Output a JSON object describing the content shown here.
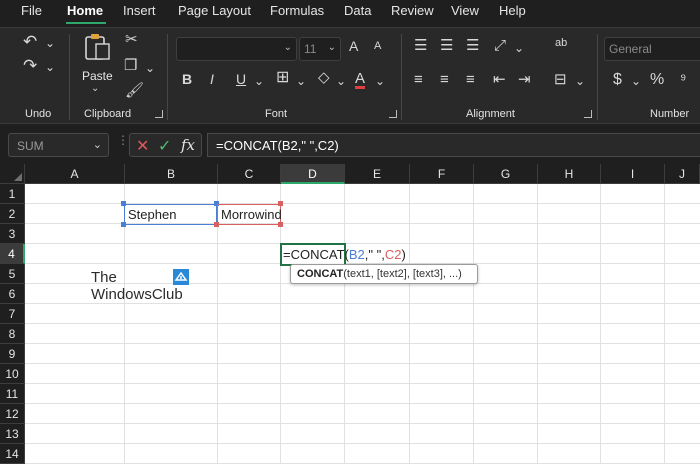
{
  "menu": {
    "items": [
      {
        "label": "File"
      },
      {
        "label": "Home"
      },
      {
        "label": "Insert"
      },
      {
        "label": "Page Layout"
      },
      {
        "label": "Formulas"
      },
      {
        "label": "Data"
      },
      {
        "label": "Review"
      },
      {
        "label": "View"
      },
      {
        "label": "Help"
      }
    ],
    "active": "Home",
    "accent": "#2ea76b"
  },
  "ribbon": {
    "groups": {
      "undo": "Undo",
      "clipboard": "Clipboard",
      "font": "Font",
      "alignment": "Alignment",
      "number": "Number"
    },
    "paste_label": "Paste",
    "font_size": "11",
    "number_format": "General",
    "currency_symbol": "$",
    "percent_symbol": "%",
    "bold_glyph": "B",
    "italic_glyph": "I",
    "underline_glyph": "U",
    "font_color_glyph": "A",
    "grow_font_glyph": "A",
    "shrink_font_glyph": "A",
    "wrap_glyph": "ab"
  },
  "formula_bar": {
    "name_box": "SUM",
    "fx_label": "fx",
    "formula": "=CONCAT(B2,\" \",C2)"
  },
  "grid": {
    "columns": [
      "A",
      "B",
      "C",
      "D",
      "E",
      "F",
      "G",
      "H",
      "I",
      "J"
    ],
    "selected_column": "D",
    "rows": [
      "1",
      "2",
      "3",
      "4",
      "5",
      "6",
      "7",
      "8",
      "9",
      "10",
      "11",
      "12",
      "13",
      "14"
    ],
    "selected_row": "4",
    "cells": {
      "B2": "Stephen",
      "C2": "Morrowind"
    },
    "active_cell": {
      "ref": "D4",
      "parts": {
        "p1": "=CONCAT(",
        "p2": "B2",
        "p3": ",\" \",",
        "p4": "C2",
        "p5": ")"
      }
    },
    "ref_colors": {
      "b2": "#4a7fd4",
      "c2": "#d86060"
    }
  },
  "tooltip": {
    "function": "CONCAT",
    "args": "(text1, [text2], [text3], ...)"
  },
  "watermark": {
    "line1": "The",
    "line2": "WindowsClub"
  }
}
